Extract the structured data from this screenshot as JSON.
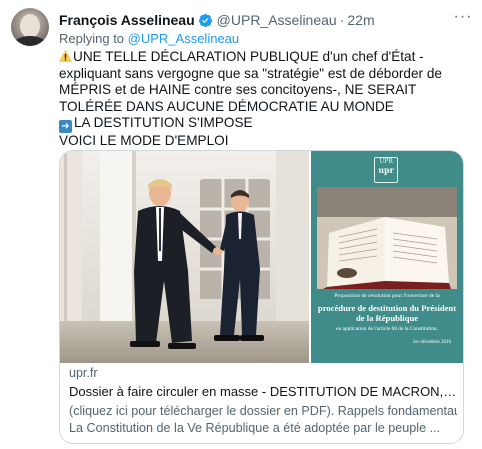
{
  "author": {
    "name": "François Asselineau",
    "handle": "@UPR_Asselineau",
    "separator": "·",
    "time": "22m",
    "verified_icon": "verified-badge-icon",
    "badge_color": "#1d9bf0"
  },
  "more_menu": {
    "icon": "more-horizontal-icon",
    "label": "···"
  },
  "reply": {
    "prefix": "Replying to ",
    "mention": "@UPR_Asselineau"
  },
  "body": {
    "line1_emoji": "warning-icon",
    "line1": "UNE TELLE DÉCLARATION PUBLIQUE d'un chef d'État -expliquant sans vergogne que sa \"stratégie\" est de déborder de MÉPRIS et de HAINE contre ses concitoyens-, NE SERAIT TOLÉRÉE DANS AUCUNE DÉMOCRATIE AU MONDE",
    "line2_emoji": "right-arrow-icon",
    "line2": "LA DESTITUTION S'IMPOSE",
    "line3": "VOICI LE MODE D'EMPLOI"
  },
  "card": {
    "source": "upr.fr",
    "title": "Dossier à faire circuler en masse - DESTITUTION DE MACRON, MODE D'EMPLOI",
    "desc_line1": "(cliquez ici pour télécharger le dossier en PDF). Rappels fondamentaux",
    "desc_line2": "La Constitution de la Ve République a été adoptée par le peuple ...",
    "doc": {
      "logo_top": "UPR",
      "logo_text": "upr",
      "caption1": "Proposition de résolution pour l'ouverture de la",
      "caption2": "procédure de destitution du Président de la République",
      "caption3": "en application de l'article 68 de la Constitution.",
      "caption4": "1er décembre 2016"
    }
  },
  "colors": {
    "accent": "#1d9bf0",
    "secondary_text": "#536471",
    "border": "#cfd9de",
    "doc_background": "#3f8c8a"
  }
}
